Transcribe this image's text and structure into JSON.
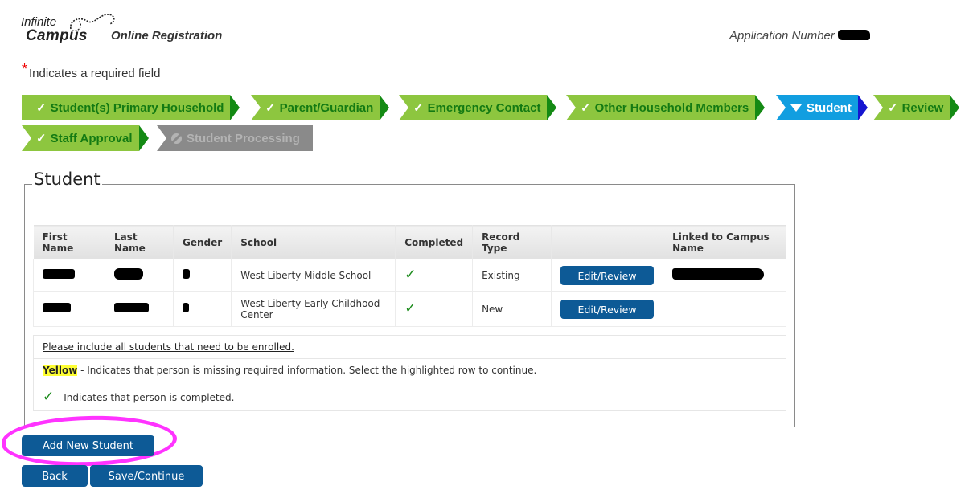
{
  "header": {
    "logo_line1": "Infinite",
    "logo_line2": "Campus",
    "app_title": "Online Registration",
    "application_number_label": "Application Number",
    "application_number_value": "[redacted]"
  },
  "required_note": {
    "marker": "*",
    "text": "Indicates a required field"
  },
  "steps": [
    {
      "label": "Student(s) Primary Household",
      "status": "completed",
      "icon": "check-icon"
    },
    {
      "label": "Parent/Guardian",
      "status": "completed",
      "icon": "check-icon"
    },
    {
      "label": "Emergency Contact",
      "status": "completed",
      "icon": "check-icon"
    },
    {
      "label": "Other Household Members",
      "status": "completed",
      "icon": "check-icon"
    },
    {
      "label": "Student",
      "status": "current",
      "icon": "caret-down-icon"
    },
    {
      "label": "Review",
      "status": "completed",
      "icon": "check-icon"
    },
    {
      "label": "Staff Approval",
      "status": "completed",
      "icon": "check-icon"
    },
    {
      "label": "Student Processing",
      "status": "disabled",
      "icon": "ban-icon"
    }
  ],
  "section": {
    "title": "Student",
    "columns": [
      "First Name",
      "Last Name",
      "Gender",
      "School",
      "Completed",
      "Record Type",
      "",
      "Linked to Campus Name"
    ],
    "rows": [
      {
        "first_name": "[redacted]",
        "last_name": "[redacted]",
        "gender": "[redacted]",
        "school": "West Liberty Middle School",
        "completed": "✓",
        "record_type": "Existing",
        "action": "Edit/Review",
        "linked_name": "[redacted]"
      },
      {
        "first_name": "[redacted]",
        "last_name": "[redacted]",
        "gender": "[redacted]",
        "school": "West Liberty Early Childhood Center",
        "completed": "✓",
        "record_type": "New",
        "action": "Edit/Review",
        "linked_name": ""
      }
    ],
    "notes": {
      "include_all": "Please include all students that need to be enrolled.",
      "yellow_label": "Yellow",
      "yellow_text": " - Indicates that person is missing required information. Select the highlighted row to continue.",
      "check_symbol": "✓",
      "check_text": " - Indicates that person is completed."
    }
  },
  "buttons": {
    "add_new_student": "Add New Student",
    "back": "Back",
    "save_continue": "Save/Continue"
  },
  "colors": {
    "step_completed": "#8dc63f",
    "step_current": "#119ee0",
    "step_disabled": "#8a8a8a",
    "button": "#0d5a96",
    "annotation": "#ff33ff"
  }
}
